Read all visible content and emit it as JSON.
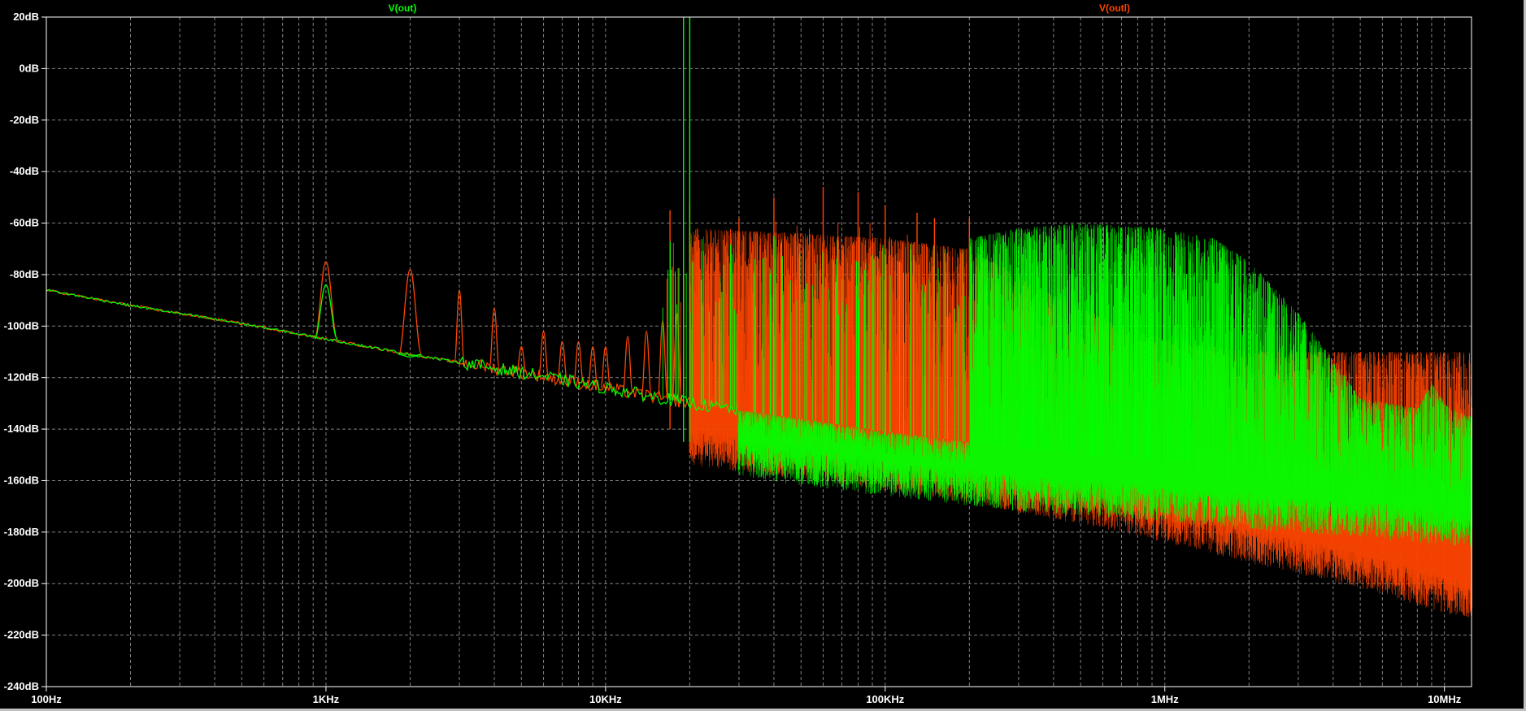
{
  "window": {
    "background": "#000000",
    "grid_color": "#808080",
    "frame_color": "#ffffff"
  },
  "chart_data": {
    "type": "line",
    "title": "",
    "xlabel": "",
    "ylabel": "",
    "xscale": "log",
    "xlim_hz": [
      100,
      12500000
    ],
    "ylim_db": [
      -240,
      20
    ],
    "grid": true,
    "legend": "top-center",
    "x_tick_labels": [
      "100Hz",
      "1KHz",
      "10KHz",
      "100KHz",
      "1MHz",
      "10MHz"
    ],
    "x_tick_values": [
      100,
      1000,
      10000,
      100000,
      1000000,
      10000000
    ],
    "y_tick_labels": [
      "20dB",
      "0dB",
      "-20dB",
      "-40dB",
      "-60dB",
      "-80dB",
      "-100dB",
      "-120dB",
      "-140dB",
      "-160dB",
      "-180dB",
      "-200dB",
      "-220dB",
      "-240dB"
    ],
    "y_tick_values": [
      20,
      0,
      -20,
      -40,
      -60,
      -80,
      -100,
      -120,
      -140,
      -160,
      -180,
      -200,
      -220,
      -240
    ],
    "series": [
      {
        "name": "V(outl)",
        "color": "#ff4500",
        "noise_floor": {
          "x": [
            100,
            200,
            500,
            1000,
            2000,
            5000,
            10000,
            20000,
            50000,
            100000,
            200000,
            500000,
            1000000,
            2000000,
            5000000,
            12000000
          ],
          "y": [
            -86,
            -92,
            -99,
            -105,
            -111,
            -118,
            -124,
            -130,
            -136,
            -141,
            -145,
            -152,
            -158,
            -165,
            -172,
            -180
          ]
        },
        "noise_band_bottom": {
          "x": [
            20000,
            50000,
            100000,
            200000,
            500000,
            1000000,
            2000000,
            5000000,
            12000000
          ],
          "y": [
            -140,
            -146,
            -150,
            -155,
            -163,
            -170,
            -178,
            -188,
            -200
          ]
        },
        "harmonics": {
          "x": [
            1000,
            2000,
            3000,
            4000,
            5000,
            6000,
            7000,
            8000,
            9000,
            10000,
            12000,
            14000,
            16000,
            18000
          ],
          "y": [
            -75,
            -78,
            -86,
            -93,
            -108,
            -102,
            -106,
            -106,
            -108,
            -108,
            -104,
            -102,
            -98,
            -95
          ]
        },
        "spurs": {
          "x": [
            17000,
            20000,
            30000,
            40000,
            60000,
            80000,
            100000,
            130000,
            150000,
            200000
          ],
          "y": [
            -55,
            -52,
            -58,
            -50,
            -46,
            -48,
            -53,
            -56,
            -58,
            -58
          ]
        },
        "envelope_top": {
          "x": [
            20000,
            50000,
            100000,
            200000,
            400000,
            700000,
            1000000,
            2000000
          ],
          "y": [
            -62,
            -64,
            -66,
            -70,
            -88,
            -100,
            -105,
            -110
          ]
        }
      },
      {
        "name": "V(out)",
        "color": "#00ff00",
        "noise_floor": {
          "x": [
            100,
            200,
            500,
            1000,
            2000,
            5000,
            10000,
            20000,
            50000,
            100000,
            200000,
            500000,
            1000000,
            2000000,
            5000000,
            12000000
          ],
          "y": [
            -86,
            -92,
            -99,
            -105,
            -111,
            -118,
            -124,
            -130,
            -136,
            -141,
            -145,
            -150,
            -152,
            -154,
            -158,
            -165
          ]
        },
        "noise_band_bottom": {
          "x": [
            30000,
            100000,
            300000,
            1000000,
            2000000,
            5000000,
            12000000
          ],
          "y": [
            -145,
            -152,
            -158,
            -162,
            -165,
            -168,
            -172
          ]
        },
        "harmonics": {
          "x": [
            1000,
            2000
          ],
          "y": [
            -84,
            -112
          ]
        },
        "spurs": {
          "x": [
            19000,
            20000,
            40000,
            80000,
            100000
          ],
          "y": [
            20,
            20,
            -65,
            -75,
            -70
          ]
        },
        "envelope_top": {
          "x": [
            200000,
            300000,
            500000,
            1000000,
            1500000,
            2000000,
            3000000,
            5000000,
            8000000,
            9000000,
            10000000,
            12000000
          ],
          "y": [
            -66,
            -62,
            -60,
            -62,
            -66,
            -75,
            -95,
            -128,
            -132,
            -122,
            -130,
            -135
          ]
        }
      }
    ]
  }
}
